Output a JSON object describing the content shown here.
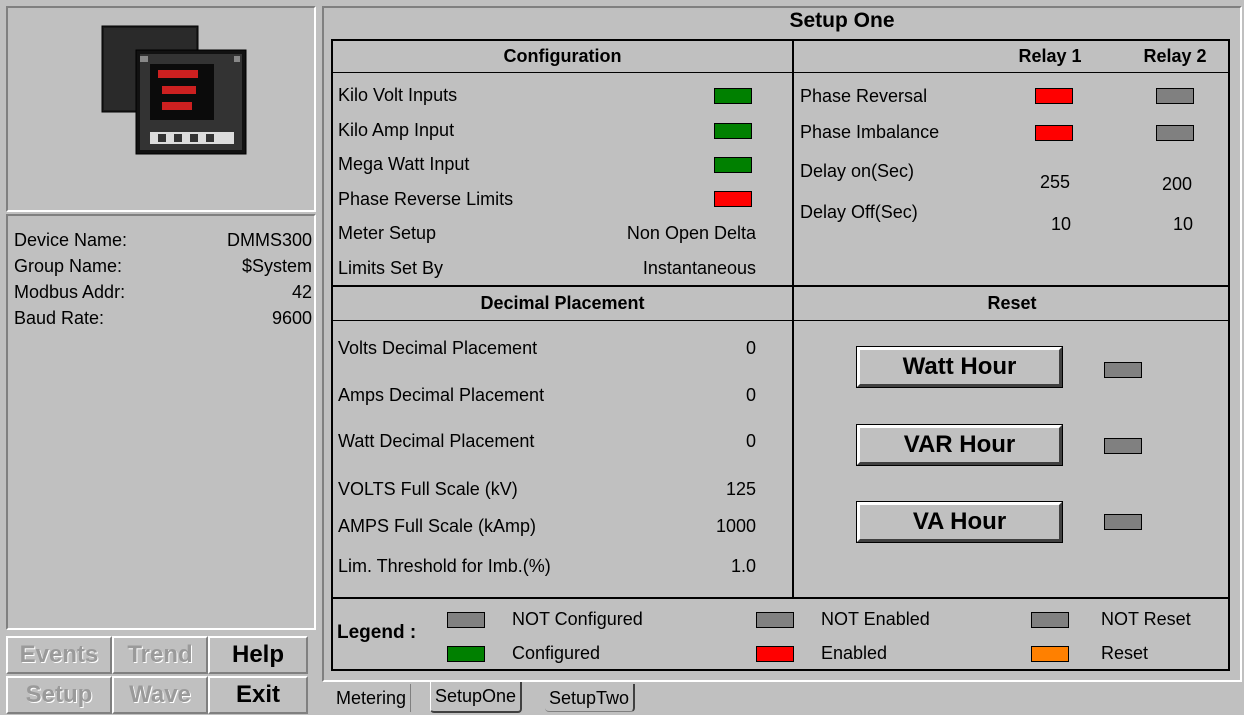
{
  "device_info": {
    "device_name_label": "Device Name:",
    "device_name_value": "DMMS300",
    "group_name_label": "Group Name:",
    "group_name_value": "$System",
    "modbus_addr_label": "Modbus Addr:",
    "modbus_addr_value": "42",
    "baud_rate_label": "Baud Rate:",
    "baud_rate_value": "9600"
  },
  "nav": {
    "events": "Events",
    "trend": "Trend",
    "help": "Help",
    "setup": "Setup",
    "wave": "Wave",
    "exit": "Exit"
  },
  "panel_title": "Setup One",
  "configuration": {
    "header": "Configuration",
    "rows": [
      {
        "label": "Kilo Volt Inputs",
        "state": "Configured"
      },
      {
        "label": "Kilo Amp Input",
        "state": "Configured"
      },
      {
        "label": "Mega Watt Input",
        "state": "Configured"
      },
      {
        "label": "Phase Reverse Limits",
        "state": "Enabled"
      },
      {
        "label": "Meter Setup",
        "value": "Non Open Delta"
      },
      {
        "label": "Limits Set By",
        "value": "Instantaneous"
      }
    ]
  },
  "relays": {
    "relay1_header": "Relay 1",
    "relay2_header": "Relay 2",
    "phase_reversal": {
      "label": "Phase Reversal",
      "relay1": "Enabled",
      "relay2": "NOT Enabled"
    },
    "phase_imbalance": {
      "label": "Phase Imbalance",
      "relay1": "Enabled",
      "relay2": "NOT Enabled"
    },
    "delay_on": {
      "label": "Delay on(Sec)",
      "relay1": "255",
      "relay2": "200"
    },
    "delay_off": {
      "label": "Delay Off(Sec)",
      "relay1": "10",
      "relay2": "10"
    }
  },
  "decimal": {
    "header": "Decimal Placement",
    "rows": [
      {
        "label": "Volts Decimal Placement",
        "value": "0"
      },
      {
        "label": "Amps Decimal Placement",
        "value": "0"
      },
      {
        "label": "Watt Decimal Placement",
        "value": "0"
      },
      {
        "label": "VOLTS Full Scale (kV)",
        "value": "125"
      },
      {
        "label": "AMPS Full Scale (kAmp)",
        "value": "1000"
      },
      {
        "label": "Lim. Threshold for Imb.(%)",
        "value": "1.0"
      }
    ]
  },
  "reset": {
    "header": "Reset",
    "buttons": [
      {
        "label": "Watt Hour",
        "state": "NOT Reset"
      },
      {
        "label": "VAR Hour",
        "state": "NOT Reset"
      },
      {
        "label": "VA Hour",
        "state": "NOT Reset"
      }
    ]
  },
  "legend": {
    "title": "Legend :",
    "not_configured": "NOT Configured",
    "configured": "Configured",
    "not_enabled": "NOT Enabled",
    "enabled": "Enabled",
    "not_reset": "NOT Reset",
    "reset": "Reset"
  },
  "colors": {
    "configured": "#008000",
    "not_configured": "#808080",
    "enabled": "#ff0000",
    "not_enabled": "#808080",
    "reset": "#ff8000",
    "not_reset": "#808080",
    "background": "#c0c0c0"
  },
  "tabs": [
    "Metering",
    "SetupOne",
    "SetupTwo"
  ],
  "active_tab": "SetupOne"
}
